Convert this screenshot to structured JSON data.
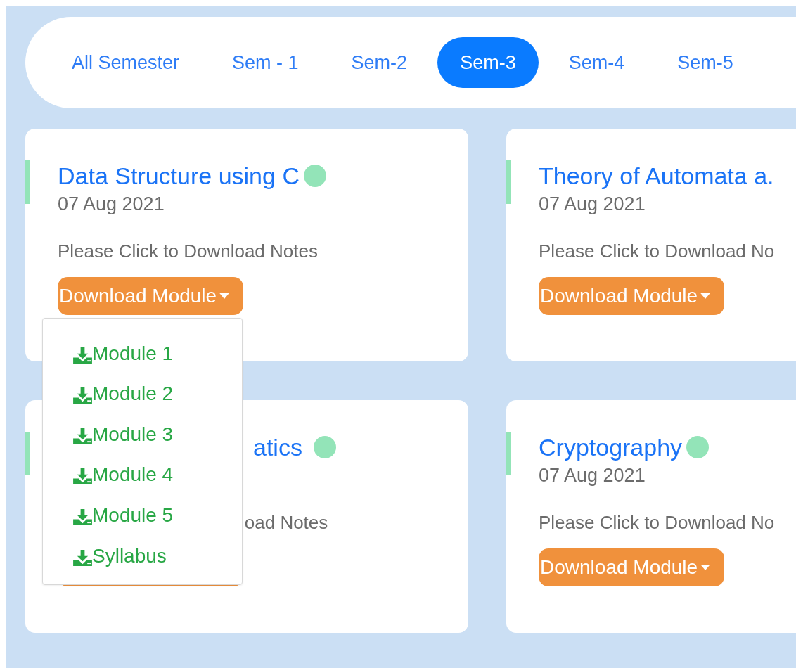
{
  "tabs": [
    {
      "label": "All Semester",
      "selected": false
    },
    {
      "label": "Sem - 1",
      "selected": false
    },
    {
      "label": "Sem-2",
      "selected": false
    },
    {
      "label": "Sem-3",
      "selected": true
    },
    {
      "label": "Sem-4",
      "selected": false
    },
    {
      "label": "Sem-5",
      "selected": false
    }
  ],
  "cards": [
    {
      "title": "Data Structure using C",
      "dot": true,
      "date": "07 Aug 2021",
      "description": "Please Click to Download Notes",
      "button": "Download Module",
      "menu_open": true,
      "covered": false
    },
    {
      "title": "Theory of Automata a.",
      "date": "07 Aug 2021",
      "description": "Please Click to Download No",
      "button": "Download Module",
      "menu_open": false,
      "covered": false
    },
    {
      "title": "atics",
      "dot": true,
      "description": "load Notes",
      "menu_open": false,
      "covered": true
    },
    {
      "title": "Cryptography",
      "dot": true,
      "date": "07 Aug 2021",
      "description": "Please Click to Download No",
      "button": "Download Module",
      "menu_open": false,
      "covered": false
    }
  ],
  "dropdown": {
    "items": [
      "Module 1",
      "Module 2",
      "Module 3",
      "Module 4",
      "Module 5",
      "Syllabus"
    ]
  }
}
